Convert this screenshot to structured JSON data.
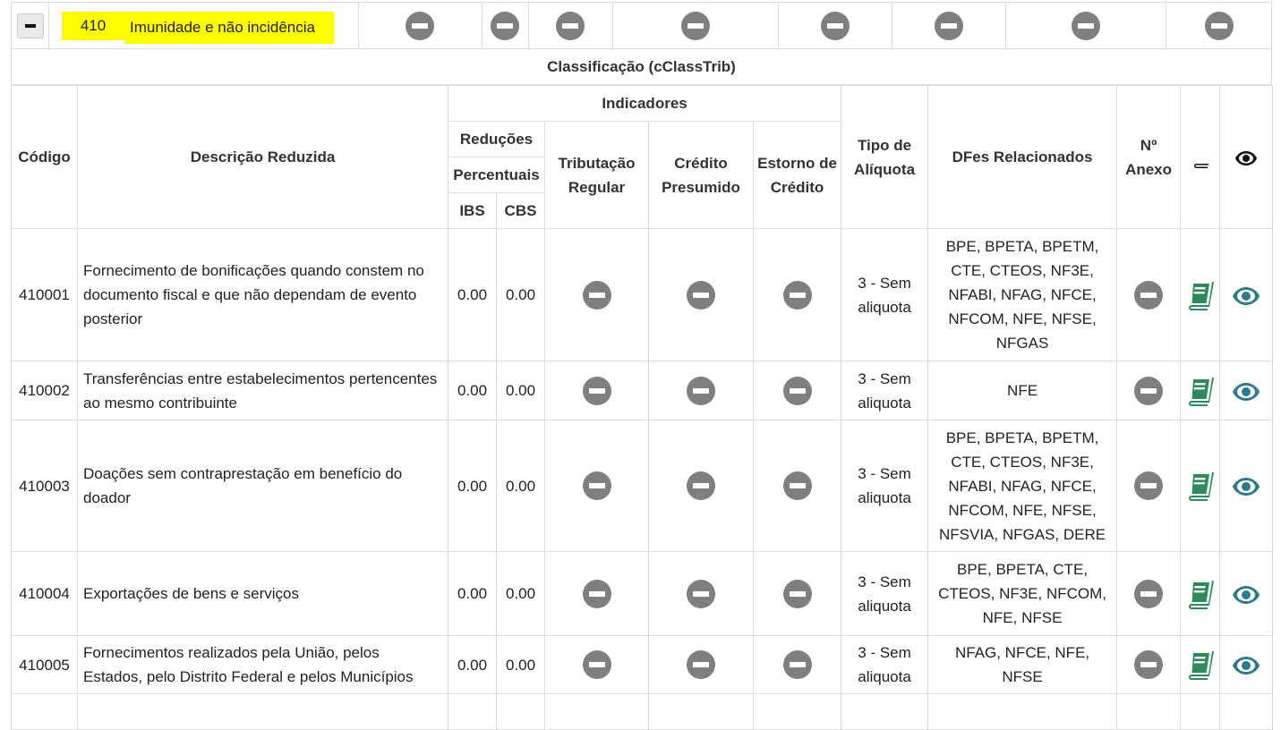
{
  "group": {
    "code": "410",
    "title": "Imunidade e não incidência"
  },
  "section_title": "Classificação (cClassTrib)",
  "headers": {
    "codigo": "Código",
    "descricao": "Descrição Reduzida",
    "indicadores": "Indicadores",
    "reducoes": "Reduções",
    "percentuais": "Percentuais",
    "ibs": "IBS",
    "cbs": "CBS",
    "tributacao": "Tributação Regular",
    "credito": "Crédito Presumido",
    "estorno": "Estorno de Crédito",
    "tipo": "Tipo de Alíquota",
    "dfes": "DFes Relacionados",
    "anexo": "Nº Anexo"
  },
  "rows": [
    {
      "codigo": "410001",
      "descricao": "Fornecimento de bonificações quando constem no documento fiscal e que não dependam de evento posterior",
      "ibs": "0.00",
      "cbs": "0.00",
      "tipo": "3 - Sem aliquota",
      "dfes": "BPE, BPETA, BPETM, CTE, CTEOS, NF3E, NFABI, NFAG, NFCE, NFCOM, NFE, NFSE, NFGAS"
    },
    {
      "codigo": "410002",
      "descricao": "Transferências entre estabelecimentos pertencentes ao mesmo contribuinte",
      "ibs": "0.00",
      "cbs": "0.00",
      "tipo": "3 - Sem aliquota",
      "dfes": "NFE"
    },
    {
      "codigo": "410003",
      "descricao": "Doações sem contraprestação em benefício do doador",
      "ibs": "0.00",
      "cbs": "0.00",
      "tipo": "3 - Sem aliquota",
      "dfes": "BPE, BPETA, BPETM, CTE, CTEOS, NF3E, NFABI, NFAG, NFCE, NFCOM, NFE, NFSE, NFSVIA, NFGAS, DERE"
    },
    {
      "codigo": "410004",
      "descricao": "Exportações de bens e serviços",
      "ibs": "0.00",
      "cbs": "0.00",
      "tipo": "3 - Sem aliquota",
      "dfes": "BPE, BPETA, CTE, CTEOS, NF3E, NFCOM, NFE, NFSE"
    },
    {
      "codigo": "410005",
      "descricao": "Fornecimentos realizados pela União, pelos Estados, pelo Distrito Federal e pelos Municípios",
      "ibs": "0.00",
      "cbs": "0.00",
      "tipo": "3 - Sem aliquota",
      "dfes": "NFAG, NFCE, NFE, NFSE"
    },
    {
      "codigo": "",
      "descricao": "",
      "ibs": "",
      "cbs": "",
      "tipo": "",
      "dfes": ""
    }
  ],
  "icons": {
    "minus": "minus-circle-icon",
    "book": "book-icon",
    "eye": "eye-icon",
    "colors": {
      "minus": "#7f7f7f",
      "book_header": "#111111",
      "book_row": "#2e8b57",
      "eye_row": "#2c7a8c",
      "highlight": "#fffb00"
    }
  }
}
